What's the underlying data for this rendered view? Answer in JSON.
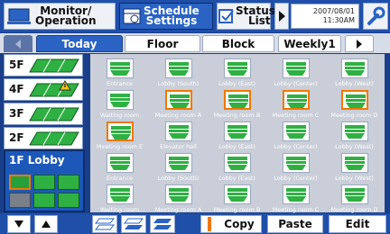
{
  "nav": {
    "monitor_label_line1": "Monitor/",
    "monitor_label_line2": "Operation",
    "schedule_label_line1": "Schedule",
    "schedule_label_line2": "Settings",
    "status_label_line1": "Status",
    "status_label_line2": "List",
    "date": "2007/08/01",
    "time": "11:30AM"
  },
  "tabs": [
    "Today",
    "Floor",
    "Block",
    "Weekly1"
  ],
  "floors": [
    "5F",
    "4F",
    "3F",
    "2F"
  ],
  "lobby_panel_title": "1F Lobby",
  "units": [
    {
      "name": "Entrance",
      "selected": false
    },
    {
      "name": "Lobby (South)",
      "selected": false
    },
    {
      "name": "Lobby (East)",
      "selected": false
    },
    {
      "name": "Lobby (Center)",
      "selected": false
    },
    {
      "name": "Lobby (West)",
      "selected": false
    },
    {
      "name": "Waiting room",
      "selected": false
    },
    {
      "name": "Meeting room A",
      "selected": true
    },
    {
      "name": "Meeting room B",
      "selected": true
    },
    {
      "name": "Meeting room C",
      "selected": true
    },
    {
      "name": "Meeting room D",
      "selected": true
    },
    {
      "name": "Meeting room E",
      "selected": true
    },
    {
      "name": "Elevator hall",
      "selected": false
    },
    {
      "name": "Lobby (East)",
      "selected": false
    },
    {
      "name": "Lobby (Center)",
      "selected": false
    },
    {
      "name": "Lobby (West)",
      "selected": false
    },
    {
      "name": "Entrance",
      "selected": false
    },
    {
      "name": "Lobby (South)",
      "selected": false
    },
    {
      "name": "Lobby (East)",
      "selected": false
    },
    {
      "name": "Lobby (Center)",
      "selected": false
    },
    {
      "name": "Lobby (West)",
      "selected": false
    },
    {
      "name": "Waiting room",
      "selected": false
    },
    {
      "name": "Meeting room A",
      "selected": false
    },
    {
      "name": "Meeting room B",
      "selected": false
    },
    {
      "name": "Meeting room C",
      "selected": false
    },
    {
      "name": "Meeting room D",
      "selected": false
    }
  ],
  "bottom": {
    "copy_label": "Copy",
    "paste_label": "Paste",
    "edit_label": "Edit"
  },
  "colors": {
    "accent_blue": "#1f4fa8",
    "selection_orange": "#f07800",
    "unit_green": "#2fb043",
    "warning_yellow": "#f3c21b"
  },
  "icons": {
    "floor_up": "up-arrow-icon",
    "floor_down": "down-arrow-icon",
    "settings_tools": "tools-icon",
    "warning": "warning-icon"
  }
}
